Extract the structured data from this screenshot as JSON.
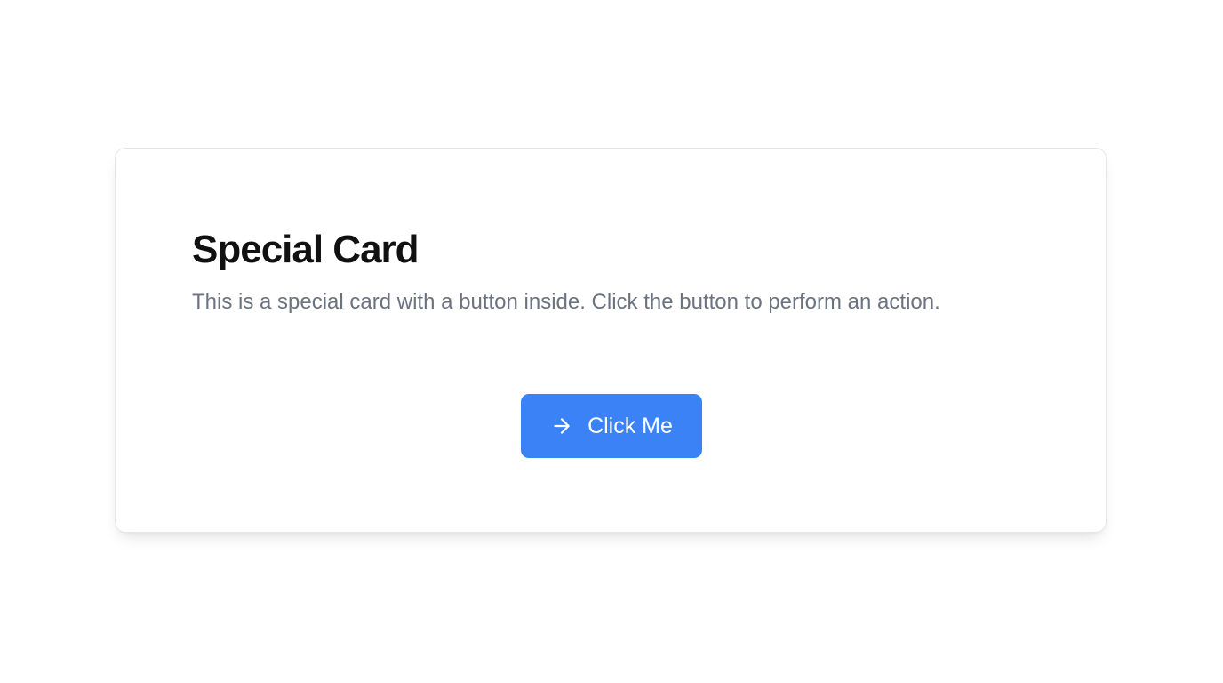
{
  "card": {
    "title": "Special Card",
    "description": "This is a special card with a button inside. Click the button to perform an action.",
    "button": {
      "label": "Click Me",
      "icon": "arrow-right-icon",
      "color": "#3b82f6"
    }
  }
}
